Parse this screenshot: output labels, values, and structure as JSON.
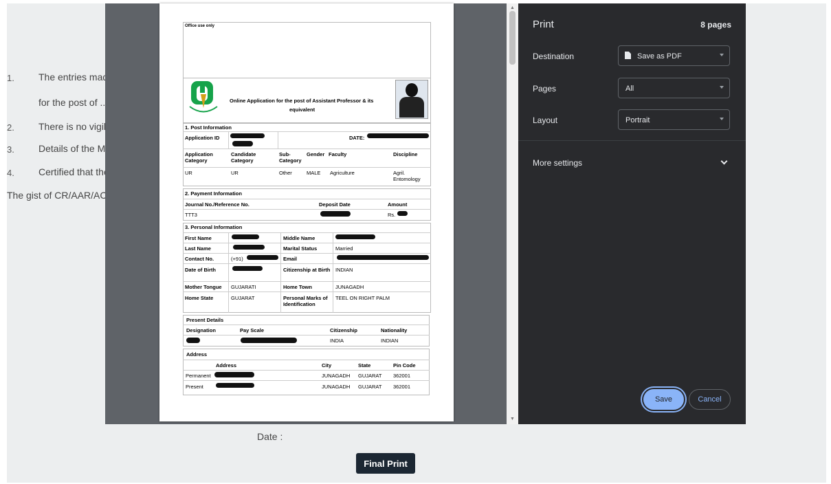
{
  "background": {
    "items": [
      {
        "num": "1.",
        "text": "The entries mad"
      },
      {
        "num": "",
        "text": "for the post of .."
      },
      {
        "num": "2.",
        "text": "There is no vigila"
      },
      {
        "num": "3.",
        "text": "Details of the Mi"
      },
      {
        "num": "4.",
        "text": "Certified that the"
      }
    ],
    "gist_text": "The gist of CR/AAR/AC",
    "date_label": "Date :",
    "final_print_label": "Final Print"
  },
  "print_dialog": {
    "title": "Print",
    "page_count": "8 pages",
    "destination_label": "Destination",
    "destination_value": "Save as PDF",
    "pages_label": "Pages",
    "pages_value": "All",
    "layout_label": "Layout",
    "layout_value": "Portrait",
    "more_settings_label": "More settings",
    "save_label": "Save",
    "cancel_label": "Cancel",
    "accent_color": "#8ab4f8"
  },
  "document": {
    "office_use": "Office use only",
    "heading": "Online Application for the post of Assistant Professor & its",
    "heading2": "equivalent",
    "post_info": {
      "title": "1. Post Information",
      "application_id_label": "Application ID",
      "date_label": "DATE:",
      "headers": [
        "Application Category",
        "Candidate Category",
        "Sub-Category",
        "Gender",
        "Faculty",
        "Discipline"
      ],
      "values": [
        "UR",
        "UR",
        "Other",
        "MALE",
        "Agriculture",
        "Agril. Entomology"
      ]
    },
    "payment_info": {
      "title": "2. Payment Information",
      "headers": [
        "Journal No./Reference No.",
        "Deposit Date",
        "Amount"
      ],
      "journal_value": "TTT3",
      "amount_prefix": "Rs."
    },
    "personal_info": {
      "title": "3. Personal Information",
      "first_name_label": "First Name",
      "middle_name_label": "Middle Name",
      "last_name_label": "Last Name",
      "marital_status_label": "Marital Status",
      "marital_status_value": "Married",
      "contact_label": "Contact No.",
      "contact_prefix": "(+91)",
      "email_label": "Email",
      "dob_label": "Date of Birth",
      "citizenship_birth_label": "Citizenship at Birth",
      "citizenship_birth_value": "INDIAN",
      "mother_tongue_label": "Mother Tongue",
      "mother_tongue_value": "GUJARATI",
      "home_town_label": "Home Town",
      "home_town_value": "JUNAGADH",
      "home_state_label": "Home State",
      "home_state_value": "GUJARAT",
      "personal_marks_label": "Personal Marks of Identification",
      "personal_marks_value": "TEEL ON RIGHT PALM"
    },
    "present_details": {
      "title": "Present Details",
      "headers": [
        "Designation",
        "Pay Scale",
        "Citizenship",
        "Nationality"
      ],
      "citizenship_value": "INDIA",
      "nationality_value": "INDIAN"
    },
    "address": {
      "title": "Address",
      "headers": [
        "Address",
        "City",
        "State",
        "Pin Code"
      ],
      "rows": [
        {
          "type": "Permanent",
          "city": "JUNAGADH",
          "state": "GUJARAT",
          "pin": "362001"
        },
        {
          "type": "Present",
          "city": "JUNAGADH",
          "state": "GUJARAT",
          "pin": "362001"
        }
      ]
    }
  }
}
